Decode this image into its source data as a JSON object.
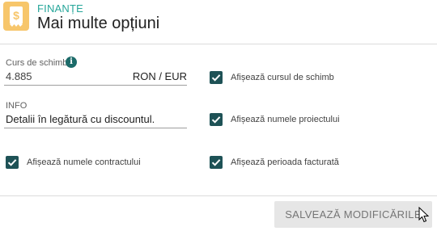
{
  "header": {
    "app_icon": "dollar-receipt-icon",
    "section_label": "FINANȚE",
    "title": "Mai multe opțiuni"
  },
  "exchange_rate": {
    "label": "Curs de schimb",
    "info_icon": "info-icon",
    "value": "4.885",
    "currency_pair": "RON / EUR"
  },
  "info_field": {
    "label": "INFO",
    "value": "Detalii în legătură cu discountul."
  },
  "checkboxes": [
    {
      "label": "Afișează cursul de schimb",
      "checked": true
    },
    {
      "label": "Afișează numele proiectului",
      "checked": true
    },
    {
      "label": "Afișează numele contractului",
      "checked": true
    },
    {
      "label": "Afișează perioada facturată",
      "checked": true
    }
  ],
  "footer": {
    "save_label": "SALVEAZĂ MODIFICĂRILE"
  },
  "colors": {
    "accent": "#26a69a",
    "checkbox": "#1e5256",
    "app_icon_bg": "#f7c66b"
  }
}
